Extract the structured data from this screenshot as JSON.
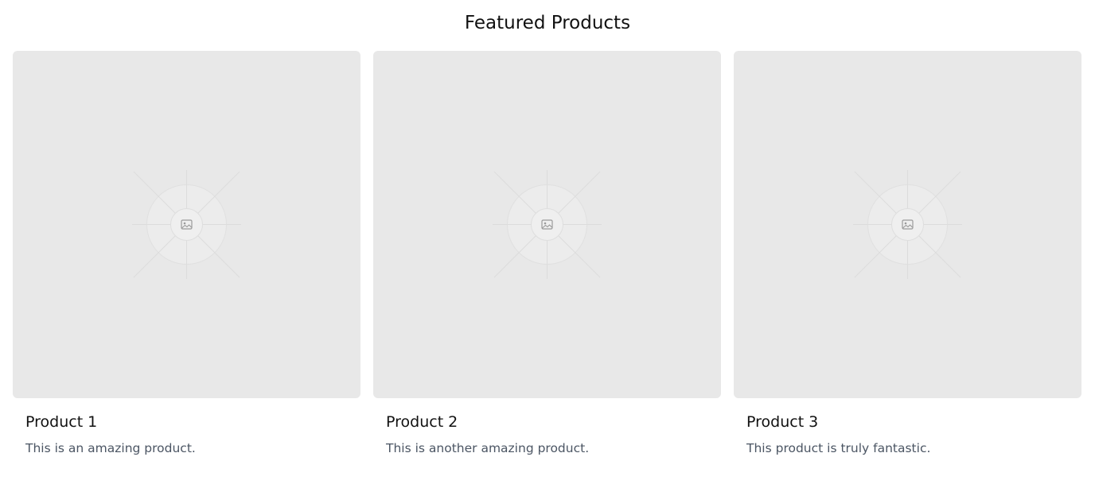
{
  "page": {
    "title": "Featured Products"
  },
  "products": [
    {
      "name": "Product 1",
      "description": "This is an amazing product."
    },
    {
      "name": "Product 2",
      "description": "This is another amazing product."
    },
    {
      "name": "Product 3",
      "description": "This product is truly fantastic."
    }
  ],
  "placeholder_icon": "image-placeholder-icon",
  "colors": {
    "image_bg": "#e8e8e8",
    "description_text": "#4b5563",
    "title_text": "#111111"
  }
}
